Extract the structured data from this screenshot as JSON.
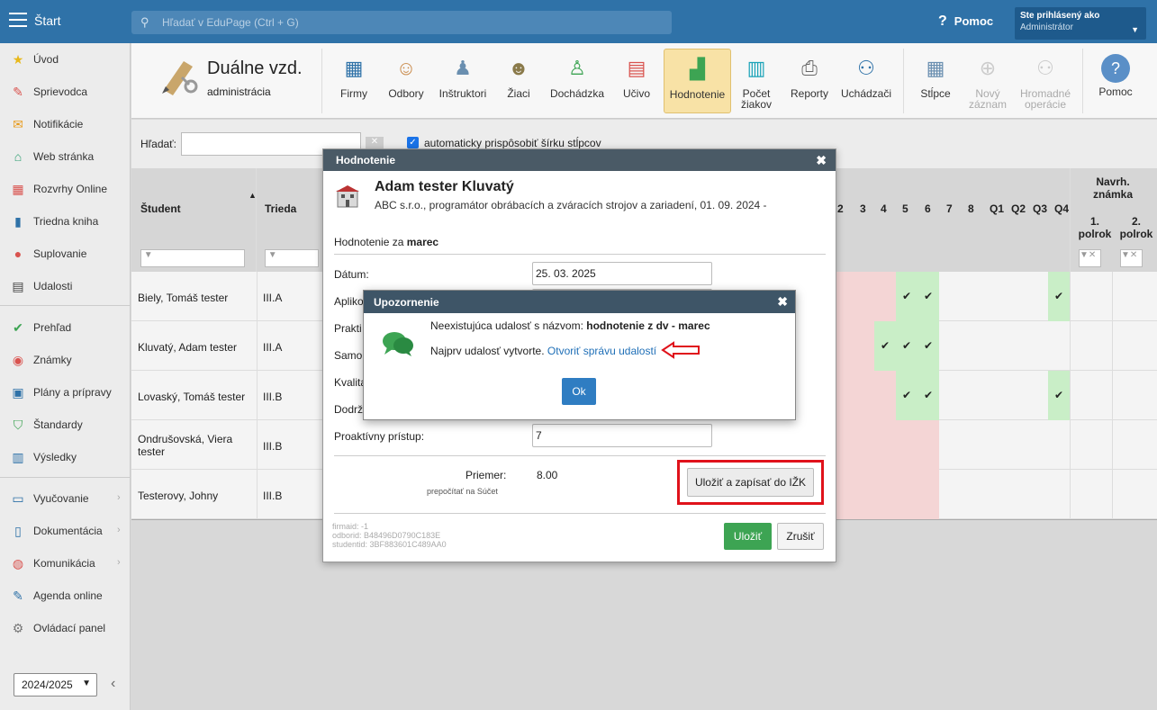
{
  "topbar": {
    "start": "Štart",
    "search_placeholder": "Hľadať v EduPage (Ctrl + G)",
    "help": "Pomoc",
    "user_line1": "Ste prihlásený ako",
    "user_line2": "Administrátor"
  },
  "sidebar": {
    "items": [
      {
        "label": "Úvod",
        "icon": "star-icon"
      },
      {
        "label": "Sprievodca",
        "icon": "wand-icon"
      },
      {
        "label": "Notifikácie",
        "icon": "envelope-icon"
      },
      {
        "label": "Web stránka",
        "icon": "home-icon"
      },
      {
        "label": "Rozvrhy Online",
        "icon": "grid-icon"
      },
      {
        "label": "Triedna kniha",
        "icon": "book-icon"
      },
      {
        "label": "Suplovanie",
        "icon": "person-icon"
      },
      {
        "label": "Udalosti",
        "icon": "calendar-icon"
      },
      {
        "label": "Prehľad",
        "icon": "check-circle-icon"
      },
      {
        "label": "Známky",
        "icon": "grade-icon"
      },
      {
        "label": "Plány a prípravy",
        "icon": "briefcase-icon"
      },
      {
        "label": "Štandardy",
        "icon": "shield-icon"
      },
      {
        "label": "Výsledky",
        "icon": "bar-chart-icon"
      },
      {
        "label": "Vyučovanie",
        "icon": "book-open-icon"
      },
      {
        "label": "Dokumentácia",
        "icon": "document-icon"
      },
      {
        "label": "Komunikácia",
        "icon": "chat-icon"
      },
      {
        "label": "Agenda online",
        "icon": "pen-icon"
      },
      {
        "label": "Ovládací panel",
        "icon": "gear-icon"
      }
    ],
    "year": "2024/2025"
  },
  "toolbar": {
    "app_title": "Duálne vzd.",
    "app_subtitle": "administrácia",
    "buttons": [
      {
        "label": "Firmy"
      },
      {
        "label": "Odbory"
      },
      {
        "label": "Inštruktori"
      },
      {
        "label": "Žiaci"
      },
      {
        "label": "Dochádzka"
      },
      {
        "label": "Učivo"
      },
      {
        "label": "Hodnotenie"
      },
      {
        "label": "Počet žiakov"
      },
      {
        "label": "Reporty"
      },
      {
        "label": "Uchádzači"
      },
      {
        "label": "Stĺpce"
      },
      {
        "label": "Nový záznam"
      },
      {
        "label": "Hromadné operácie"
      },
      {
        "label": "Pomoc"
      }
    ]
  },
  "filter": {
    "search_label": "Hľadať:",
    "auto_width_label": "automaticky prispôsobiť šírku stĺpcov"
  },
  "grid": {
    "col_student": "Študent",
    "col_class": "Trieda",
    "week_cols": [
      "2",
      "3",
      "4",
      "5",
      "6",
      "7",
      "8",
      "Q1",
      "Q2",
      "Q3",
      "Q4"
    ],
    "proposed_title": "Navrh. známka",
    "sem1": "1. polrok",
    "sem2": "2. polrok",
    "rows": [
      {
        "student": "Biely, Tomáš tester",
        "class": "III.A"
      },
      {
        "student": "Kluvatý, Adam tester",
        "class": "III.A"
      },
      {
        "student": "Lovaský, Tomáš tester",
        "class": "III.B"
      },
      {
        "student": "Ondrušovská, Viera tester",
        "class": "III.B"
      },
      {
        "student": "Testerovy, Johny",
        "class": "III.B"
      }
    ]
  },
  "dialog": {
    "title": "Hodnotenie",
    "student_name": "Adam tester Kluvatý",
    "firm_line": "ABC s.r.o., programátor obrábacích a zváracích strojov a zariadení, 01. 09. 2024 -",
    "period_label": "Hodnotenie za",
    "period_value": "marec",
    "fields": [
      {
        "label": "Dátum:",
        "value": "25. 03. 2025"
      },
      {
        "label": "Apliko",
        "value": ""
      },
      {
        "label": "Prakti",
        "value": ""
      },
      {
        "label": "Samo",
        "value": ""
      },
      {
        "label": "Kvalita",
        "value": ""
      },
      {
        "label": "Dodrž",
        "value": ""
      },
      {
        "label": "Proaktívny prístup:",
        "value": "7"
      }
    ],
    "average_label": "Priemer:",
    "average_value": "8.00",
    "recalc_label": "prepočítať na Súčet",
    "save_write_label": "Uložiť a zapísať do IŽK",
    "footer_lines": [
      "firmaid: -1",
      "odborid: B48496D0790C183E",
      "studentid: 3BF883601C489AA0"
    ],
    "save_label": "Uložiť",
    "cancel_label": "Zrušiť"
  },
  "warning": {
    "title": "Upozornenie",
    "msg1_prefix": "Neexistujúca udalosť s názvom:",
    "msg1_bold": "hodnotenie z dv - marec",
    "msg2_prefix": "Najprv udalosť vytvorte.",
    "msg2_link": "Otvoriť správu udalostí",
    "ok_label": "Ok"
  },
  "colors": {
    "topbar": "#2f72a8",
    "active_tab": "#f8e2a6",
    "highlight_red": "#e0121b",
    "cell_green": "#c9eec7",
    "cell_pink": "#f4d5d5"
  }
}
